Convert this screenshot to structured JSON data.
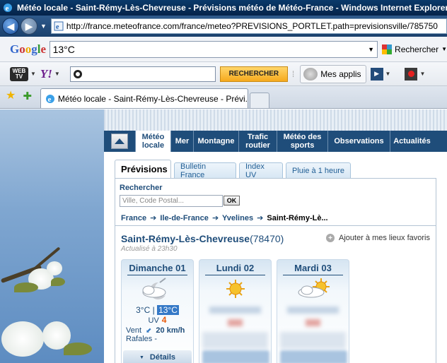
{
  "browser": {
    "window_title": "Météo locale - Saint-Rémy-Lès-Chevreuse - Prévisions météo de Météo-France - Windows Internet Explorer",
    "url": "http://france.meteofrance.com/france/meteo?PREVISIONS_PORTLET.path=previsionsville/785750",
    "tab_title": "Météo locale - Saint-Rémy-Lès-Chevreuse - Prévi..."
  },
  "google_toolbar": {
    "logo": "Google",
    "query": "13°C",
    "search_button": "Rechercher"
  },
  "yahoo_toolbar": {
    "tv_label": "WEB TV",
    "logo": "Y!",
    "search_button": "RECHERCHER",
    "apps_button": "Mes applis"
  },
  "site": {
    "nav": [
      {
        "label": "Météo locale",
        "active": true
      },
      {
        "label": "Mer"
      },
      {
        "label": "Montagne"
      },
      {
        "label": "Trafic routier"
      },
      {
        "label": "Météo des sports"
      },
      {
        "label": "Observations"
      },
      {
        "label": "Actualités"
      }
    ],
    "tabs": [
      "Prévisions",
      "Bulletin France",
      "Index UV",
      "Pluie à 1 heure"
    ],
    "search": {
      "label": "Rechercher",
      "placeholder": "Ville, Code Postal...",
      "ok": "OK"
    },
    "breadcrumb": [
      "France",
      "Ile-de-France",
      "Yvelines",
      "Saint-Rémy-Lè..."
    ],
    "city": "Saint-Rémy-Lès-Chevreuse",
    "postcode": "(78470)",
    "updated": "Actualisé à 23h30",
    "add_favorite": "Ajouter à mes lieux favoris",
    "days": [
      {
        "name": "Dimanche 01",
        "icon": "cloud-moon-icon",
        "temp_min": "3°C",
        "temp_max": "13°C",
        "uv_label": "UV",
        "uv": "4",
        "wind_label": "Vent",
        "wind": "20 km/h",
        "rafales": "Rafales -",
        "details": "Détails"
      },
      {
        "name": "Lundi 02",
        "icon": "sun-icon"
      },
      {
        "name": "Mardi 03",
        "icon": "sun-cloud-icon"
      }
    ]
  }
}
